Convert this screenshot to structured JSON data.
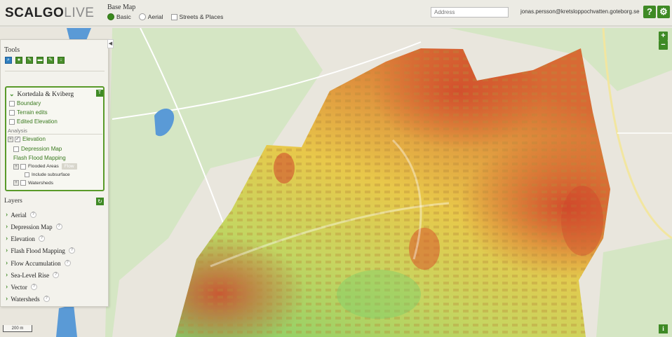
{
  "header": {
    "logo_main": "SCALGO",
    "logo_sub": "LIVE",
    "basemap_title": "Base Map",
    "basemap_options": [
      {
        "label": "Basic",
        "selected": true
      },
      {
        "label": "Aerial",
        "selected": false
      },
      {
        "label": "Streets & Places",
        "checked": false
      }
    ],
    "address_placeholder": "Address",
    "user_email": "jonas.persson@kretsloppochvatten.goteborg.se",
    "help_label": "?",
    "settings_icon": "gear-icon"
  },
  "tools": {
    "title": "Tools",
    "icons": [
      "search-icon",
      "marker-icon",
      "pencil-icon",
      "folder-icon",
      "pencil-icon",
      "download-icon"
    ]
  },
  "project": {
    "title": "Kortedala & Kviberg",
    "items": [
      "Boundary",
      "Terrain edits",
      "Edited Elevation"
    ],
    "analysis_label": "Analysis",
    "elevation_label": "Elevation",
    "depression_label": "Depression Map",
    "flash_flood_label": "Flash Flood Mapping",
    "flooded_areas_label": "Flooded Areas",
    "flow_label": "Flow",
    "include_subsurface_label": "Include subsurface",
    "watersheds_label": "Watersheds"
  },
  "layers": {
    "title": "Layers",
    "items": [
      "Aerial",
      "Depression Map",
      "Elevation",
      "Flash Flood Mapping",
      "Flow Accumulation",
      "Sea-Level Rise",
      "Vector",
      "Watersheds"
    ]
  },
  "map": {
    "zoom_in": "+",
    "zoom_out": "−",
    "info": "i",
    "scale_label": "200 m"
  },
  "colors": {
    "accent": "#3f8a25",
    "water": "#5a9ad6",
    "elev_low": "#8ccf6a",
    "elev_mid": "#e8c84a",
    "elev_high": "#d8502f"
  }
}
